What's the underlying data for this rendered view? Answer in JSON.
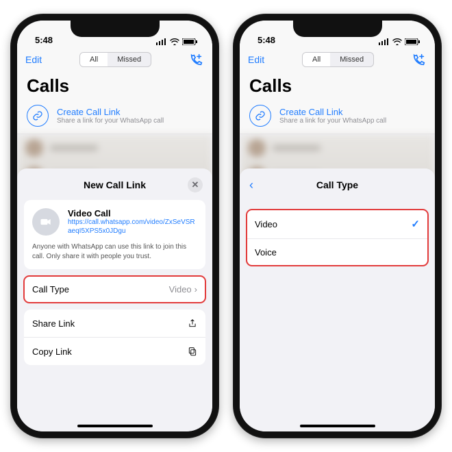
{
  "status": {
    "time": "5:48"
  },
  "nav": {
    "edit": "Edit",
    "all": "All",
    "missed": "Missed"
  },
  "page": {
    "title": "Calls",
    "create_link": "Create Call Link",
    "create_sub": "Share a link for your WhatsApp call"
  },
  "sheet_new": {
    "title": "New Call Link",
    "call_name": "Video Call",
    "call_url": "https://call.whatsapp.com/video/ZxSeVSRaeqI5XPS5x0JDgu",
    "desc": "Anyone with WhatsApp can use this link to join this call. Only share it with people you trust.",
    "call_type_label": "Call Type",
    "call_type_value": "Video",
    "share_link": "Share Link",
    "copy_link": "Copy Link"
  },
  "sheet_type": {
    "title": "Call Type",
    "options": {
      "video": "Video",
      "voice": "Voice"
    },
    "selected": "video"
  }
}
